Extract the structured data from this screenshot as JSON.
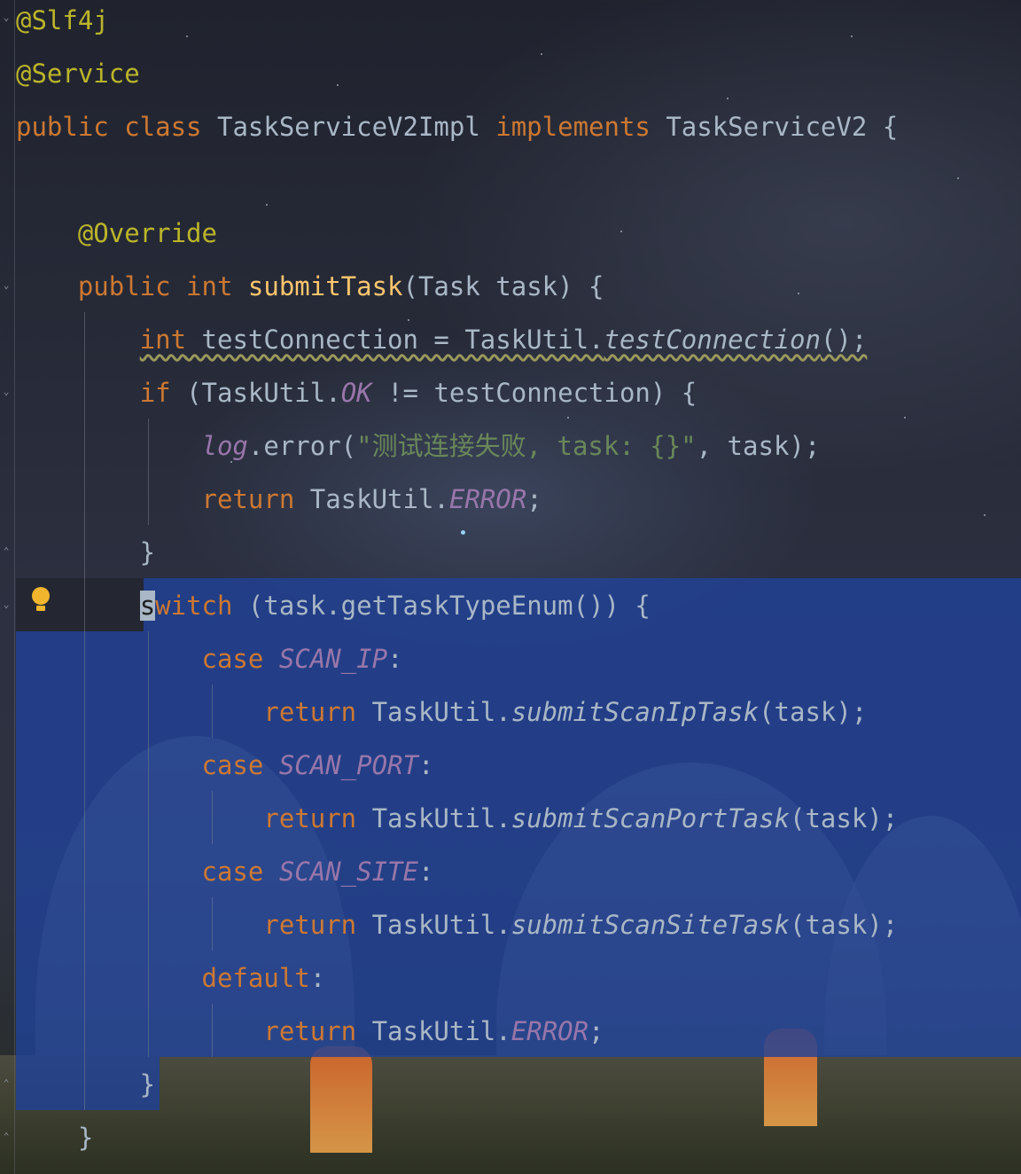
{
  "editor": {
    "lines": [
      [
        {
          "t": "@Slf4j",
          "c": "ann"
        }
      ],
      [
        {
          "t": "@Service",
          "c": "ann"
        }
      ],
      [
        {
          "t": "public class ",
          "c": "kw"
        },
        {
          "t": "TaskServiceV2Impl "
        },
        {
          "t": "implements ",
          "c": "kw"
        },
        {
          "t": "TaskServiceV2 {"
        }
      ],
      [],
      [
        {
          "t": "    "
        },
        {
          "t": "@Override",
          "c": "ann"
        }
      ],
      [
        {
          "t": "    "
        },
        {
          "t": "public int ",
          "c": "kw"
        },
        {
          "t": "submitTask",
          "c": "fn"
        },
        {
          "t": "(Task task) {"
        }
      ],
      [
        {
          "t": "        "
        },
        {
          "t": "int",
          "c": "kw warn"
        },
        {
          "t": " testConnection = TaskUtil.",
          "c": "warn"
        },
        {
          "t": "testConnection",
          "c": "it warn"
        },
        {
          "t": "();",
          "c": "warn"
        }
      ],
      [
        {
          "t": "        "
        },
        {
          "t": "if ",
          "c": "kw"
        },
        {
          "t": "(TaskUtil."
        },
        {
          "t": "OK",
          "c": "const"
        },
        {
          "t": " != testConnection) {"
        }
      ],
      [
        {
          "t": "            "
        },
        {
          "t": "log",
          "c": "log"
        },
        {
          "t": ".error("
        },
        {
          "t": "\"测试连接失败, task: {}\"",
          "c": "str"
        },
        {
          "t": ", task);"
        }
      ],
      [
        {
          "t": "            "
        },
        {
          "t": "return ",
          "c": "kw"
        },
        {
          "t": "TaskUtil."
        },
        {
          "t": "ERROR",
          "c": "const"
        },
        {
          "t": ";"
        }
      ],
      [
        {
          "t": "        }"
        }
      ],
      [
        {
          "t": "        "
        },
        {
          "t": "s",
          "c": "cursor-ch"
        },
        {
          "t": "witch ",
          "c": "kw"
        },
        {
          "t": "(task.getTaskTypeEnum()) {"
        }
      ],
      [
        {
          "t": "            "
        },
        {
          "t": "case ",
          "c": "kw"
        },
        {
          "t": "SCAN_IP",
          "c": "const"
        },
        {
          "t": ":"
        }
      ],
      [
        {
          "t": "                "
        },
        {
          "t": "return ",
          "c": "kw"
        },
        {
          "t": "TaskUtil."
        },
        {
          "t": "submitScanIpTask",
          "c": "it"
        },
        {
          "t": "(task);"
        }
      ],
      [
        {
          "t": "            "
        },
        {
          "t": "case ",
          "c": "kw"
        },
        {
          "t": "SCAN_PORT",
          "c": "const"
        },
        {
          "t": ":"
        }
      ],
      [
        {
          "t": "                "
        },
        {
          "t": "return ",
          "c": "kw"
        },
        {
          "t": "TaskUtil."
        },
        {
          "t": "submitScanPortTask",
          "c": "it"
        },
        {
          "t": "(task);"
        }
      ],
      [
        {
          "t": "            "
        },
        {
          "t": "case ",
          "c": "kw"
        },
        {
          "t": "SCAN_SITE",
          "c": "const"
        },
        {
          "t": ":"
        }
      ],
      [
        {
          "t": "                "
        },
        {
          "t": "return ",
          "c": "kw"
        },
        {
          "t": "TaskUtil."
        },
        {
          "t": "submitScanSiteTask",
          "c": "it"
        },
        {
          "t": "(task);"
        }
      ],
      [
        {
          "t": "            "
        },
        {
          "t": "default",
          "c": "kw"
        },
        {
          "t": ":"
        }
      ],
      [
        {
          "t": "                "
        },
        {
          "t": "return ",
          "c": "kw"
        },
        {
          "t": "TaskUtil."
        },
        {
          "t": "ERROR",
          "c": "const"
        },
        {
          "t": ";"
        }
      ],
      [
        {
          "t": "        }"
        }
      ],
      [
        {
          "t": "    }"
        }
      ]
    ],
    "intention_icon": "lightbulb-icon",
    "colors": {
      "default_text": "#a9b7c6",
      "keyword": "#cc7832",
      "annotation": "#bbb529",
      "method_declaration": "#ffc66d",
      "constant": "#9876aa",
      "string": "#6a8759",
      "selection": "#214296",
      "intention_bulb": "#f1b52e"
    }
  }
}
